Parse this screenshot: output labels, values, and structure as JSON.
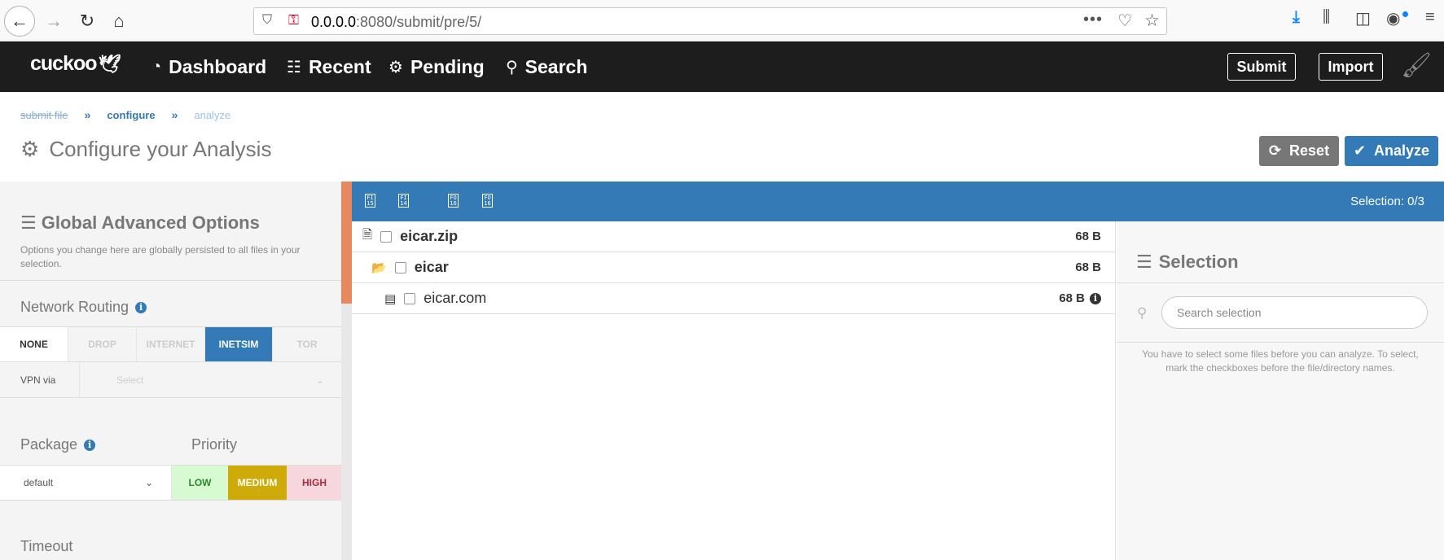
{
  "browser": {
    "url_host": "0.0.0.0",
    "url_rest": ":8080/submit/pre/5/",
    "more_label": "•••"
  },
  "nav": {
    "logo": "cuckoo",
    "items": [
      {
        "label": "Dashboard",
        "icon": "dashboard-icon"
      },
      {
        "label": "Recent",
        "icon": "list-icon"
      },
      {
        "label": "Pending",
        "icon": "gears-icon"
      },
      {
        "label": "Search",
        "icon": "search-icon"
      }
    ],
    "submit_label": "Submit",
    "import_label": "Import"
  },
  "breadcrumb": {
    "done": "submit file",
    "active": "configure",
    "next": "analyze",
    "separator": "»"
  },
  "page": {
    "title": "Configure your Analysis",
    "reset_label": "Reset",
    "analyze_label": "Analyze"
  },
  "options": {
    "title": "Global Advanced Options",
    "description": "Options you change here are globally persisted to all files in your selection.",
    "network_routing_label": "Network Routing",
    "routes": [
      "NONE",
      "DROP",
      "INTERNET",
      "INETSIM",
      "TOR"
    ],
    "selected_route": "INETSIM",
    "vpn_label": "VPN via",
    "vpn_placeholder": "Select",
    "package_label": "Package",
    "package_value": "default",
    "priority_label": "Priority",
    "priorities": [
      "LOW",
      "MEDIUM",
      "HIGH"
    ],
    "priority_selected": "MEDIUM",
    "timeout_label": "Timeout"
  },
  "tree": {
    "toolbar_icons": [
      "FI 15",
      "FI 14",
      "FO 16",
      "FO 16"
    ],
    "selection_count": "Selection: 0/3",
    "rows": [
      {
        "name": "eicar.zip",
        "size": "68 B",
        "type": "archive"
      },
      {
        "name": "eicar",
        "size": "68 B",
        "type": "folder"
      },
      {
        "name": "eicar.com",
        "size": "68 B",
        "type": "file"
      }
    ]
  },
  "selection": {
    "title": "Selection",
    "search_placeholder": "Search selection",
    "help": "You have to select some files before you can analyze. To select, mark the checkboxes before the file/directory names."
  },
  "colors": {
    "primary": "#337ab7",
    "nav_bg": "#1d1d1d",
    "scroll_thumb": "#e9875f",
    "priority_low": "#d8fad2",
    "priority_medium": "#cfab0a",
    "priority_high": "#f7d7de"
  }
}
